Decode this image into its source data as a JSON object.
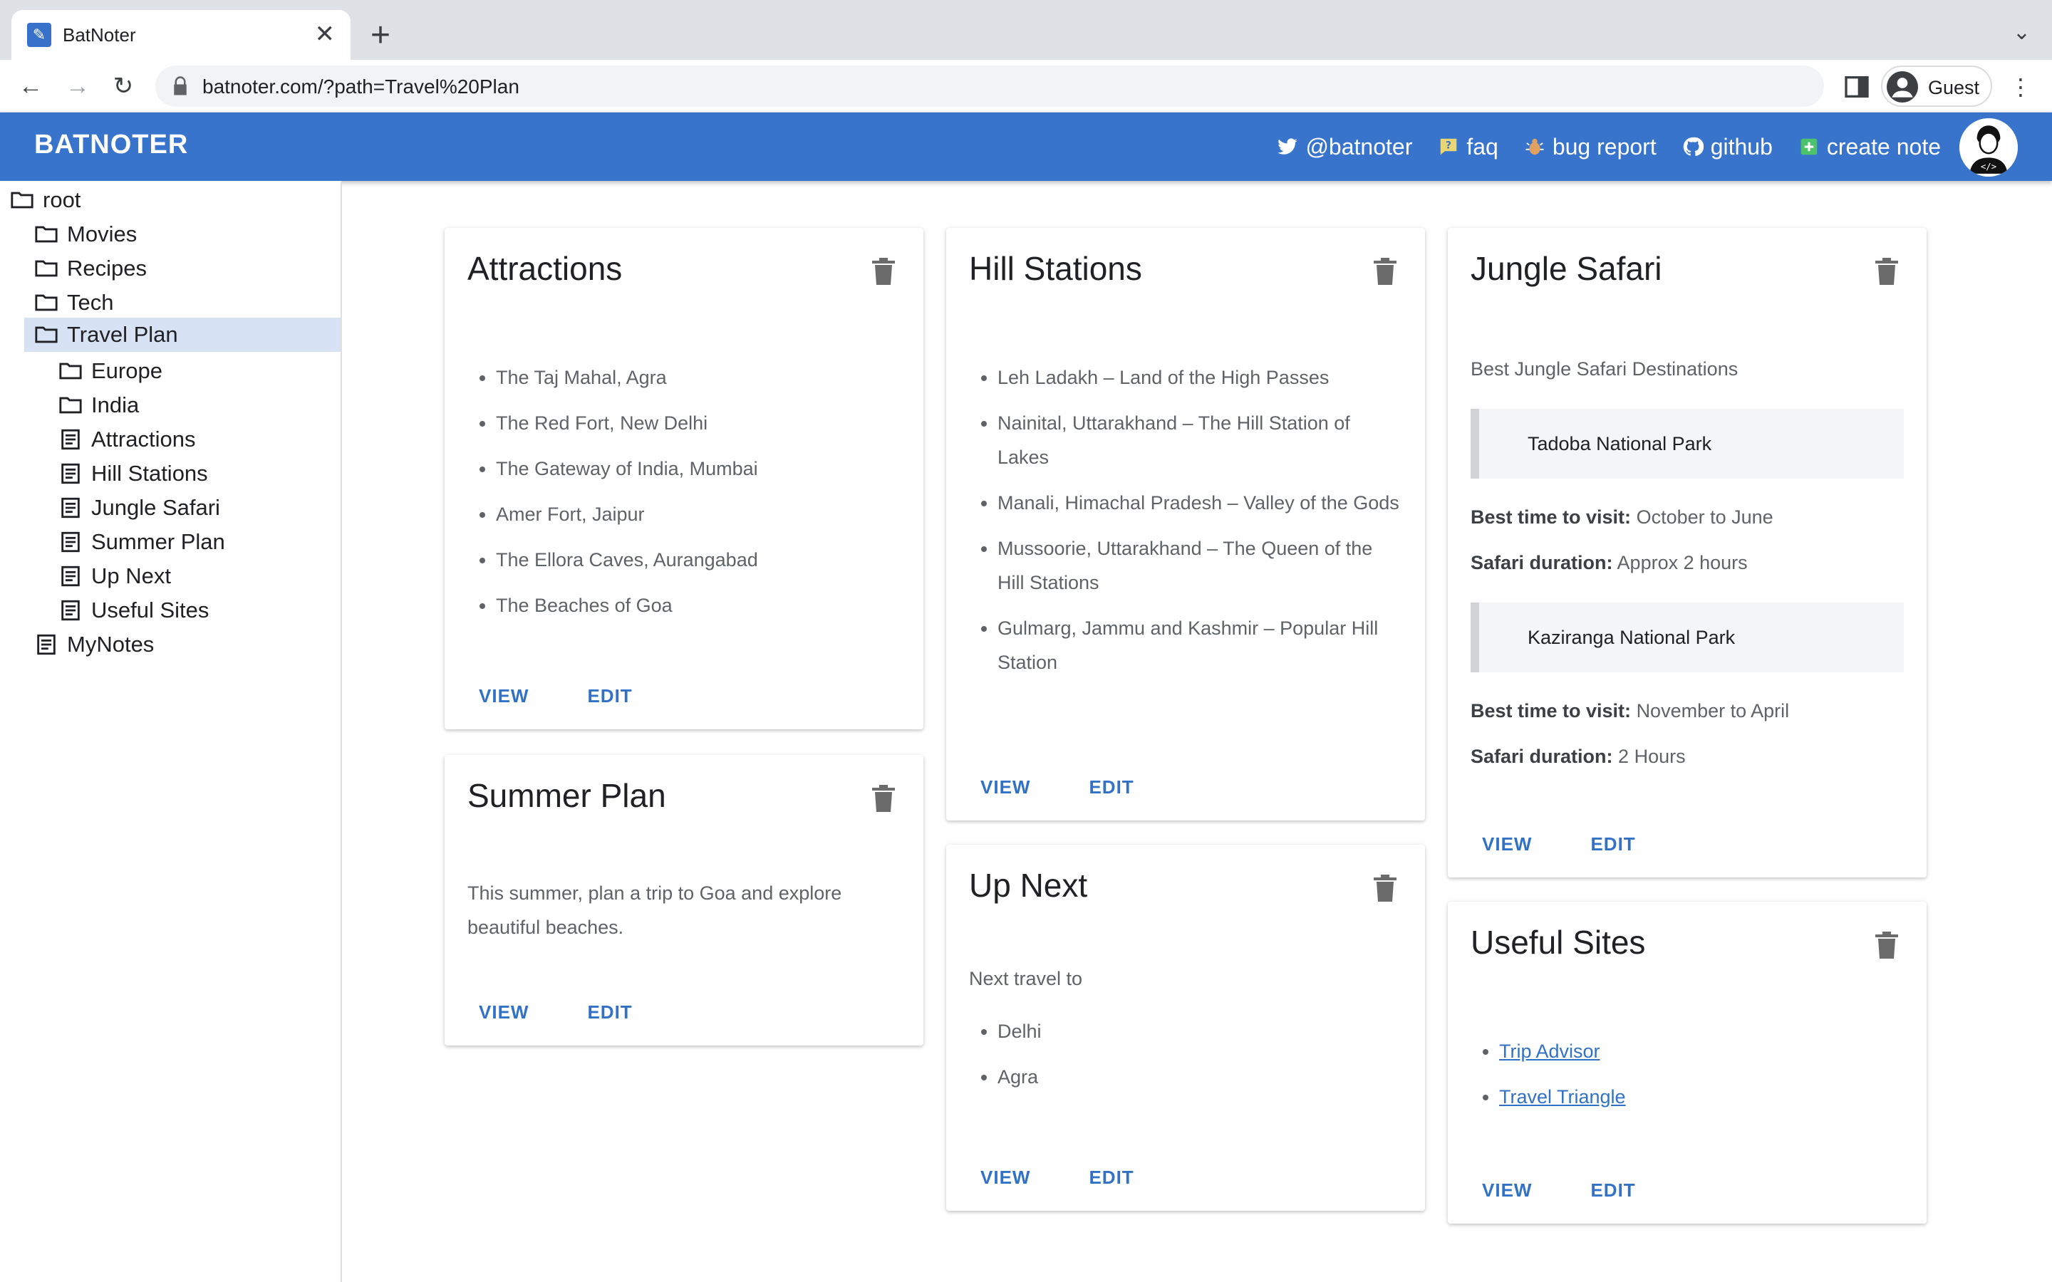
{
  "browser": {
    "tab_title": "BatNoter",
    "tab_close": "✕",
    "new_tab": "+",
    "url": "batnoter.com/?path=Travel%20Plan",
    "profile_label": "Guest"
  },
  "appbar": {
    "brand": "BATNOTER",
    "nav": [
      {
        "label": "@batnoter",
        "icon": "twitter-icon"
      },
      {
        "label": "faq",
        "icon": "faq-icon"
      },
      {
        "label": "bug report",
        "icon": "bug-icon"
      },
      {
        "label": "github",
        "icon": "github-icon"
      },
      {
        "label": "create note",
        "icon": "plus-square-icon"
      }
    ]
  },
  "sidebar": {
    "items": [
      {
        "label": "root",
        "type": "folder"
      },
      {
        "label": "Movies",
        "type": "folder"
      },
      {
        "label": "Recipes",
        "type": "folder"
      },
      {
        "label": "Tech",
        "type": "folder"
      },
      {
        "label": "Travel Plan",
        "type": "folder",
        "selected": true
      },
      {
        "label": "Europe",
        "type": "folder"
      },
      {
        "label": "India",
        "type": "folder"
      },
      {
        "label": "Attractions",
        "type": "note"
      },
      {
        "label": "Hill Stations",
        "type": "note"
      },
      {
        "label": "Jungle Safari",
        "type": "note"
      },
      {
        "label": "Summer Plan",
        "type": "note"
      },
      {
        "label": "Up Next",
        "type": "note"
      },
      {
        "label": "Useful Sites",
        "type": "note"
      },
      {
        "label": "MyNotes",
        "type": "note"
      }
    ]
  },
  "actions": {
    "view": "VIEW",
    "edit": "EDIT"
  },
  "cards": {
    "attractions": {
      "title": "Attractions",
      "items": [
        "The Taj Mahal, Agra",
        "The Red Fort, New Delhi",
        "The Gateway of India, Mumbai",
        "Amer Fort, Jaipur",
        "The Ellora Caves, Aurangabad",
        "The Beaches of Goa"
      ]
    },
    "summer": {
      "title": "Summer Plan",
      "text": "This summer, plan a trip to Goa and explore beautiful beaches."
    },
    "hill": {
      "title": "Hill Stations",
      "items": [
        "Leh Ladakh – Land of the High Passes",
        "Nainital, Uttarakhand – The Hill Station of Lakes",
        "Manali, Himachal Pradesh – Valley of the Gods",
        "Mussoorie, Uttarakhand – The Queen of the Hill Stations",
        "Gulmarg, Jammu and Kashmir – Popular Hill Station"
      ]
    },
    "upnext": {
      "title": "Up Next",
      "intro": "Next travel to",
      "items": [
        "Delhi",
        "Agra"
      ]
    },
    "jungle": {
      "title": "Jungle Safari",
      "intro": "Best Jungle Safari Destinations",
      "parks": [
        {
          "name": "Tadoba National Park",
          "best_label": "Best time to visit:",
          "best": "October to June",
          "dur_label": "Safari duration:",
          "dur": "Approx 2 hours"
        },
        {
          "name": "Kaziranga National Park",
          "best_label": "Best time to visit:",
          "best": "November to April",
          "dur_label": "Safari duration:",
          "dur": "2 Hours"
        }
      ]
    },
    "useful": {
      "title": "Useful Sites",
      "links": [
        "Trip Advisor",
        "Travel Triangle"
      ]
    }
  }
}
